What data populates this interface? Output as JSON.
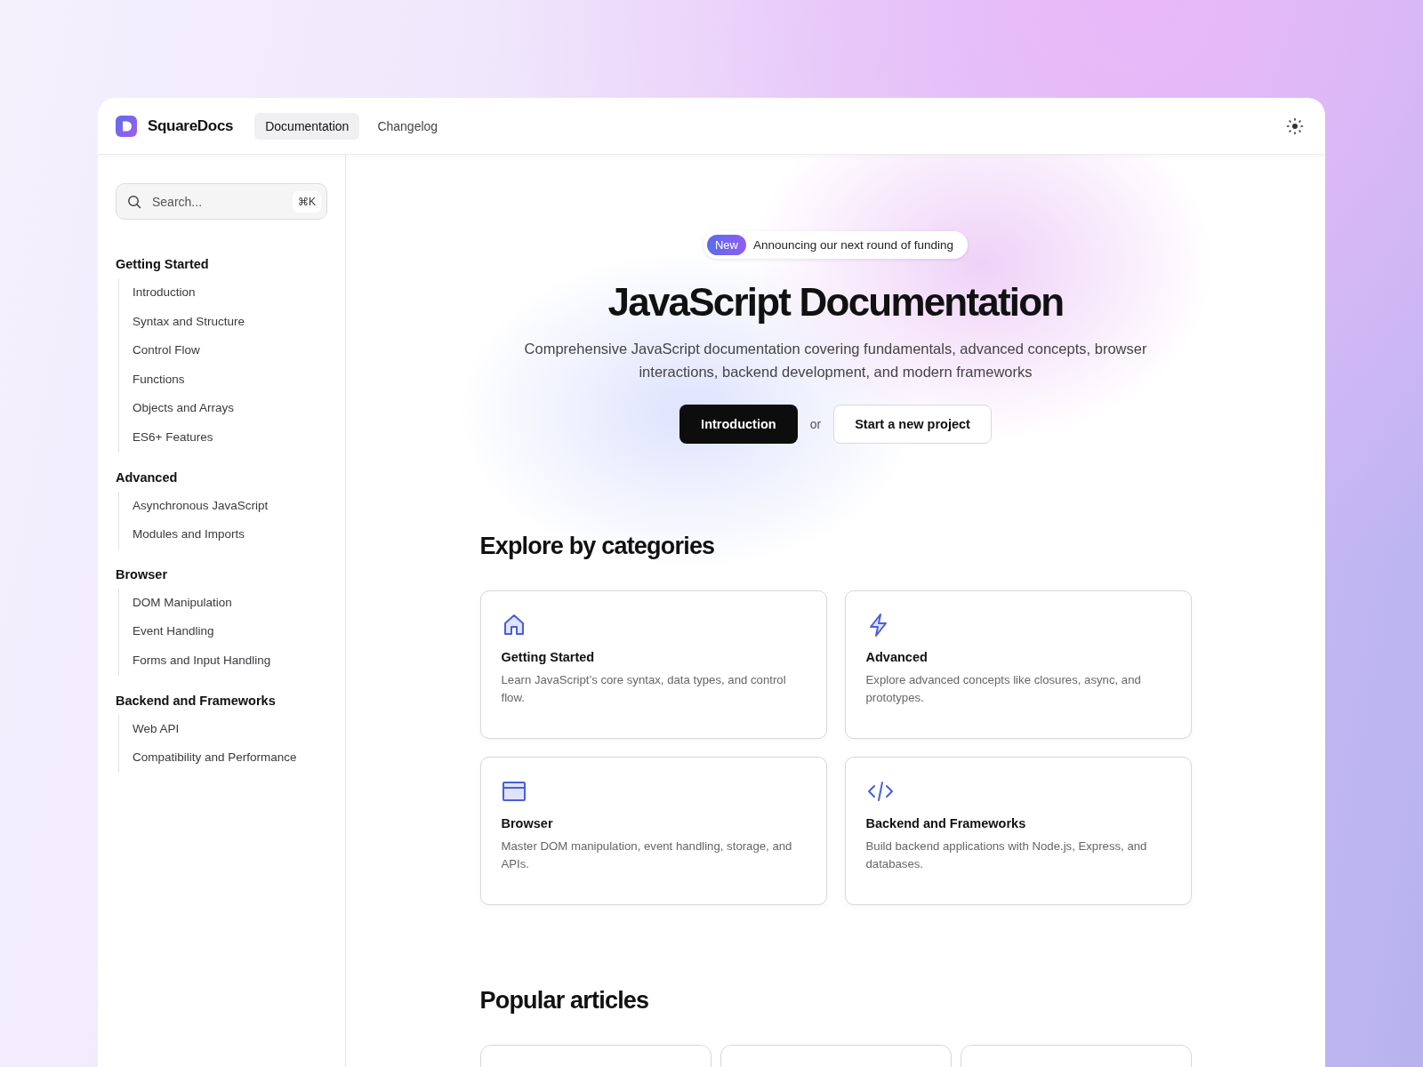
{
  "header": {
    "logo": "SquareDocs",
    "tabs": [
      {
        "label": "Documentation",
        "selected": true
      },
      {
        "label": "Changelog",
        "selected": false
      }
    ]
  },
  "sidebar": {
    "search": {
      "placeholder": "Search...",
      "shortcut": "⌘K"
    },
    "groups": [
      {
        "title": "Getting Started",
        "children": [
          "Introduction",
          "Syntax and Structure",
          "Control Flow",
          "Functions",
          "Objects and Arrays",
          "ES6+ Features"
        ]
      },
      {
        "title": "Advanced",
        "children": [
          "Asynchronous JavaScript",
          "Modules and Imports"
        ]
      },
      {
        "title": "Browser",
        "children": [
          "DOM Manipulation",
          "Event Handling",
          "Forms and Input Handling"
        ]
      },
      {
        "title": "Backend and Frameworks",
        "children": [
          "Web API",
          "Compatibility and Performance"
        ]
      }
    ]
  },
  "hero": {
    "badge": "New",
    "announcement": "Announcing our next round of funding",
    "title": "JavaScript Documentation",
    "subtitle": "Comprehensive JavaScript documentation covering fundamentals, advanced concepts, browser interactions, backend development, and modern frameworks",
    "primary_button": "Introduction",
    "separator": "or",
    "secondary_button": "Start a new project"
  },
  "categories": {
    "heading": "Explore by categories",
    "cards": [
      {
        "kind": "house",
        "title": "Getting Started",
        "description": "Learn JavaScript’s core syntax, data types, and control flow."
      },
      {
        "kind": "bolt",
        "title": "Advanced",
        "description": "Explore advanced concepts like closures, async, and prototypes."
      },
      {
        "kind": "window",
        "title": "Browser",
        "description": "Master DOM manipulation, event handling, storage, and APIs."
      },
      {
        "kind": "code",
        "title": "Backend and Frameworks",
        "description": "Build backend applications with Node.js, Express, and databases."
      }
    ]
  },
  "popular": {
    "heading": "Popular articles"
  }
}
